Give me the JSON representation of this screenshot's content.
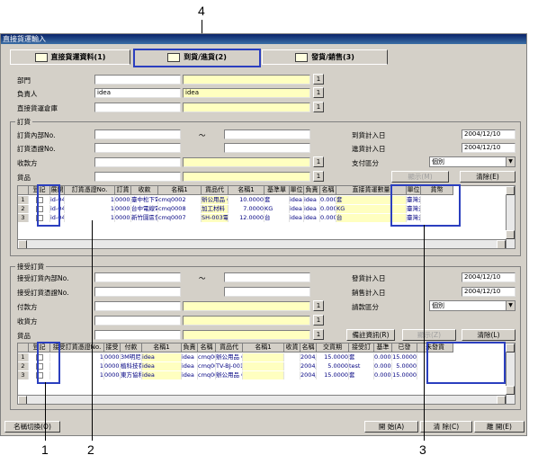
{
  "callouts": {
    "c4": "4",
    "c1": "1",
    "c2": "2",
    "c3": "3"
  },
  "window": {
    "title": "直接貨運輸入"
  },
  "tabs": [
    {
      "label": "直接貨運資料(1)"
    },
    {
      "label": "到貨/進貨(2)"
    },
    {
      "label": "發貨/銷售(3)"
    }
  ],
  "header": {
    "dept_label": "部門",
    "owner_label": "負責人",
    "owner_code": "idea",
    "owner_name": "idea",
    "warehouse_label": "直接貨運倉庫",
    "one": "1"
  },
  "order": {
    "group": "訂貨",
    "order_no_label": "訂貨內部No.",
    "order_ref_label": "訂貨憑證No.",
    "tilde": "～",
    "receiver_label": "收款方",
    "goods_label": "貨品",
    "plan_date_label": "到貨計入日",
    "plan_date": "2004/12/10",
    "in_date_label": "進貨計入日",
    "in_date": "2004/12/10",
    "pay_label": "支付區分",
    "pay_value": "個別",
    "show_btn": "顯示(M)",
    "clear_btn": "清除(E)",
    "columns": [
      "登記",
      "展開",
      "訂貨憑證No.",
      "訂貨",
      "收款",
      "名稱1",
      "貨品代",
      "名稱1",
      "基準單",
      "單位",
      "負責",
      "名稱",
      "直接貨運數量",
      "單位",
      "貨幣"
    ],
    "rows": [
      [
        "1",
        "",
        "id-041200000002",
        "1",
        "000026",
        "臺中松下電子",
        "cmq0002",
        "辦公用品 GF",
        "10.0000",
        "套",
        "idea",
        "idea",
        "0.0000",
        "套",
        "臺灣元"
      ],
      [
        "2",
        "",
        "id-041200000001",
        "1",
        "000029",
        "台中電線電纜",
        "cmq0008",
        "加工材料",
        "7.0000",
        "KG",
        "idea",
        "idea",
        "0.0000",
        "KG",
        "臺灣元"
      ],
      [
        "3",
        "",
        "id-041100000001",
        "1",
        "000037",
        "新竹園區包裝",
        "cmq0007",
        "SH-003電腦",
        "12.0000",
        "台",
        "idea",
        "idea",
        "0.0000",
        "台",
        "臺灣元"
      ]
    ]
  },
  "receive": {
    "group": "接受訂貨",
    "order_no_label": "接受訂貨內部No.",
    "order_ref_label": "接受訂貨憑證No.",
    "payer_label": "付款方",
    "shipto_label": "收貨方",
    "goods_label": "貨品",
    "ship_date_label": "發貨計入日",
    "ship_date": "2004/12/10",
    "sale_date_label": "銷售計入日",
    "sale_date": "2004/12/10",
    "bill_label": "請款區分",
    "bill_value": "個別",
    "ship_info_btn": "備註資訊(R)",
    "show_btn": "顯示(Z)",
    "clear_btn": "清除(L)",
    "columns": [
      "登記",
      "接受訂貨憑證No.",
      "接受",
      "付款",
      "名稱1",
      "負責",
      "名稱",
      "貨品代",
      "名稱1",
      "收貨",
      "名稱",
      "交貨期",
      "接受訂",
      "基準",
      "已發",
      "未發貨"
    ],
    "rows": [
      [
        "1",
        "id-041200000002",
        "1",
        "000001",
        "3M明尼蘇達礦",
        "idea",
        "idea",
        "cmq0002",
        "辦公用品 GF",
        "",
        "",
        "2004/12/10",
        "15.0000",
        "套",
        "0.0000",
        "15.0000"
      ],
      [
        "2",
        "id-041200000001",
        "1",
        "000027",
        "植科技有限公",
        "idea",
        "idea",
        "cmq003",
        "TV-BJ-001",
        "",
        "",
        "2004/12/10",
        "5.0000",
        "test",
        "0.0000",
        "5.0000"
      ],
      [
        "3",
        "id-041100000005",
        "1",
        "000048",
        "東方協和塑料",
        "idea",
        "idea",
        "cmq0002",
        "辦公用品 GF",
        "",
        "",
        "2004/11/19",
        "15.0000",
        "套",
        "0.0000",
        "15.0000"
      ]
    ]
  },
  "footer": {
    "switch_btn": "名稱切換(O)",
    "start_btn": "開 始(A)",
    "clear_btn": "清 除(C)",
    "close_btn": "離 開(E)"
  }
}
